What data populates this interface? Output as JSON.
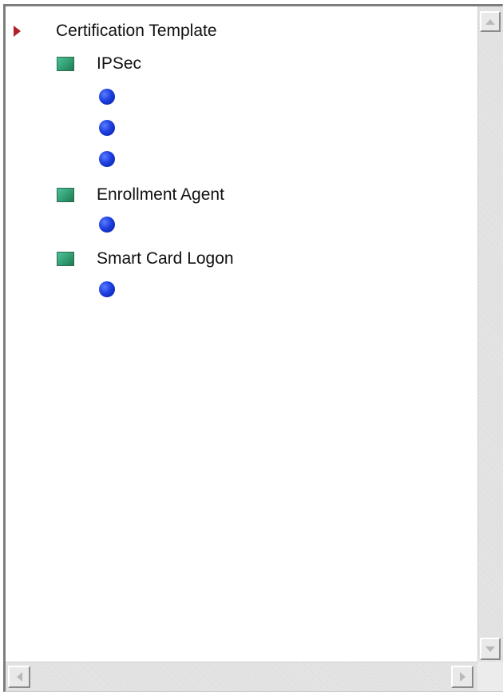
{
  "tree": {
    "root": {
      "label": "Certification Template",
      "icon": "red-arrow-icon"
    },
    "groups": [
      {
        "label": "IPSec",
        "icon": "green-square-icon",
        "leaf_count": 3,
        "leaf_icon": "blue-dot-icon"
      },
      {
        "label": "Enrollment Agent",
        "icon": "green-square-icon",
        "leaf_count": 1,
        "leaf_icon": "blue-dot-icon"
      },
      {
        "label": "Smart Card Logon",
        "icon": "green-square-icon",
        "leaf_count": 1,
        "leaf_icon": "blue-dot-icon"
      }
    ]
  },
  "colors": {
    "root_arrow": "#b0202a",
    "group_square": "#2f9a6e",
    "leaf_dot": "#1c3fe0"
  }
}
